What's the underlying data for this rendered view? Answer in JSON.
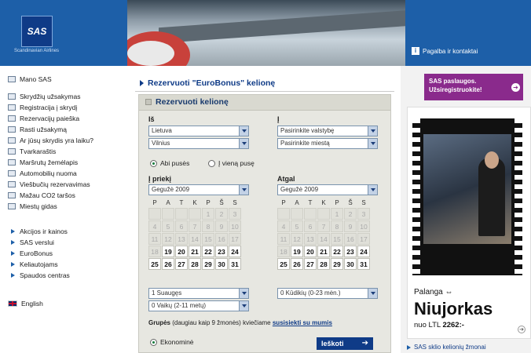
{
  "header": {
    "logo_text": "SAS",
    "logo_sub": "Scandinavian Airlines",
    "contact": "Pagalba ir kontaktai",
    "contact_icon": "info-icon"
  },
  "sidebar": {
    "items": [
      {
        "label": "Mano SAS",
        "icon": "user-icon"
      },
      {
        "label": "Skrydžių užsakymas",
        "icon": "plane-icon"
      },
      {
        "label": "Registracija į skrydį",
        "icon": "checkin-icon"
      },
      {
        "label": "Rezervacijų paieška",
        "icon": "search-icon"
      },
      {
        "label": "Rasti užsakymą",
        "icon": "find-icon"
      },
      {
        "label": "Ar jūsų skrydis yra laiku?",
        "icon": "clock-icon"
      },
      {
        "label": "Tvarkaraštis",
        "icon": "calendar-icon"
      },
      {
        "label": "Maršrutų žemėlapis",
        "icon": "map-icon"
      },
      {
        "label": "Automobilių nuoma",
        "icon": "car-icon"
      },
      {
        "label": "Viešbučių rezervavimas",
        "icon": "hotel-icon"
      },
      {
        "label": "Mažau CO2 taršos",
        "icon": "leaf-icon"
      },
      {
        "label": "Miestų gidas",
        "icon": "guide-icon"
      }
    ],
    "links": [
      "Akcijos ir kainos",
      "SAS verslui",
      "EuroBonus",
      "Keliautojams",
      "Spaudos centras"
    ],
    "language": "English"
  },
  "main": {
    "title": "Rezervuoti \"EuroBonus\" kelionę",
    "panel_title": "Rezervuoti kelionę",
    "from_label": "Iš",
    "to_label": "Į",
    "from_country": "Lietuva",
    "from_city": "Vilnius",
    "to_country": "Pasirinkite valstybę",
    "to_city": "Pasirinkite miestą",
    "trip_both": "Abi pusės",
    "trip_one": "Į vieną pusę",
    "out_label": "Į priekį",
    "back_label": "Atgal",
    "out_month": "Gegužė 2009",
    "back_month": "Gegužė 2009",
    "weekdays": [
      "P",
      "A",
      "T",
      "K",
      "P",
      "Š",
      "S"
    ],
    "cal_rows": [
      [
        "",
        "",
        "",
        "",
        "1",
        "2",
        "3"
      ],
      [
        "4",
        "5",
        "6",
        "7",
        "8",
        "9",
        "10"
      ],
      [
        "11",
        "12",
        "13",
        "14",
        "15",
        "16",
        "17"
      ],
      [
        "18",
        "19",
        "20",
        "21",
        "22",
        "23",
        "24"
      ],
      [
        "25",
        "26",
        "27",
        "28",
        "29",
        "30",
        "31"
      ]
    ],
    "adults": "1 Suaugęs",
    "children": "0 Vaikų (2-11 metų)",
    "infants": "0 Kūdikių (0-23 mėn.)",
    "group_bold": "Grupės",
    "group_text": " (daugiau kaip 9 žmonės) kviečiame ",
    "group_link": "susisiekti su mumis",
    "class_economy": "Ekonominė",
    "search_button": "Ieškoti"
  },
  "right": {
    "promo_line1": "SAS paslaugos.",
    "promo_line2": "Užsiregistruokite!",
    "ad_route": "Palanga ⇔",
    "ad_city": "Niujorkas",
    "ad_price_prefix": "nuo LTL ",
    "ad_price": "2262:-",
    "bottom_link": "SAS sklio kelionių žmonai"
  },
  "colors": {
    "brand_blue": "#1d5fa8",
    "navy": "#0f3b87",
    "promo_purple": "#8a2a8c",
    "panel": "#e7e7e1"
  }
}
